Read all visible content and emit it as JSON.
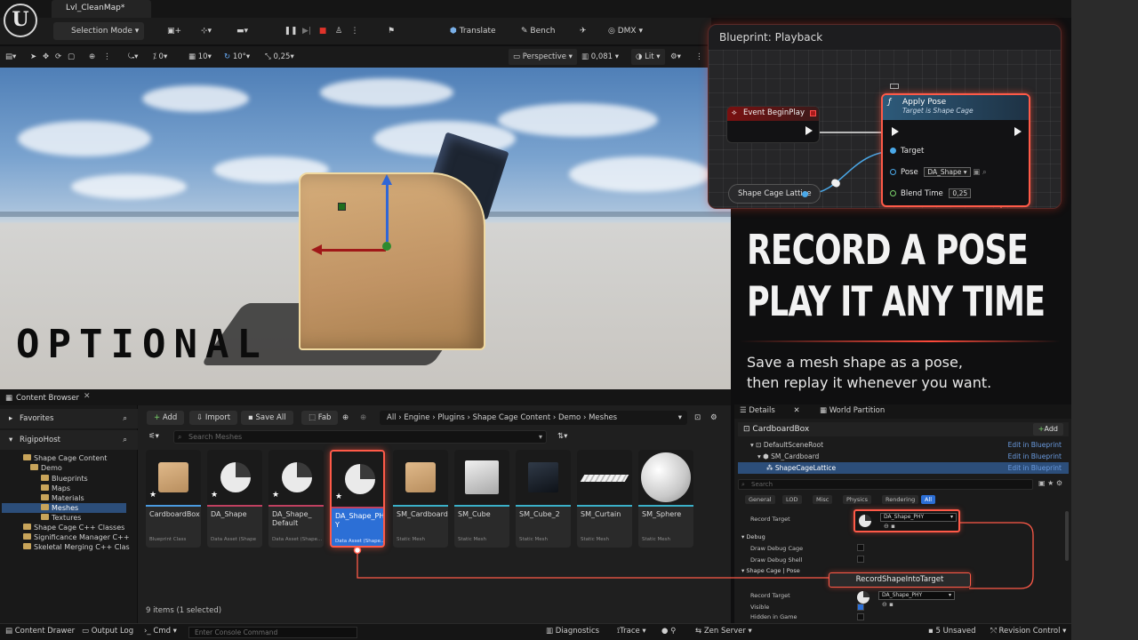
{
  "title_bar": {
    "level_tab": "Lvl_CleanMap*",
    "logo_letter": "U"
  },
  "toolbar": {
    "mode": "Selection Mode",
    "translate": "Translate",
    "bench": "Bench",
    "dmx": "DMX"
  },
  "viewport_toolbar": {
    "grid_snap": "0",
    "grid_size": "10",
    "rot_snap": "10°",
    "scale_snap": "0,25",
    "view_mode": "Perspective",
    "camera_speed": "0,081",
    "lit": "Lit"
  },
  "viewport": {
    "overlay_text": "OPTIONAL"
  },
  "promo": {
    "line1": "RECORD A POSE",
    "line2": "PLAY IT ANY TIME",
    "sub1": "Save a mesh shape as a pose,",
    "sub2": "then replay it whenever you want."
  },
  "blueprint": {
    "title": "Blueprint: Playback",
    "event_node": "Event BeginPlay",
    "apply_title": "Apply Pose",
    "apply_subtitle": "Target is Shape Cage",
    "pin_target": "Target",
    "pin_pose": "Pose",
    "pose_value": "DA_Shape",
    "pin_blend": "Blend Time",
    "blend_value": "0,25",
    "lattice_node": "Shape Cage Lattice"
  },
  "content_browser": {
    "tab": "Content Browser",
    "favorites": "Favorites",
    "root": "RigipoHost",
    "tree": [
      "Shape Cage Content",
      "Demo",
      "Blueprints",
      "Maps",
      "Materials",
      "Meshes",
      "Textures",
      "Shape Cage C++ Classes",
      "Significance Manager C++",
      "Skeletal Merging C++ Clas"
    ],
    "buttons": {
      "add": "Add",
      "import": "Import",
      "save_all": "Save All",
      "fab": "Fab"
    },
    "breadcrumb": [
      "All",
      "Engine",
      "Plugins",
      "Shape Cage Content",
      "Demo",
      "Meshes"
    ],
    "search_placeholder": "Search Meshes",
    "assets": [
      {
        "name": "CardboardBox",
        "type": "Blueprint Class"
      },
      {
        "name": "DA_Shape",
        "type": "Data Asset (Shape"
      },
      {
        "name": "DA_Shape_ Default",
        "type": "Data Asset (Shape..."
      },
      {
        "name": "DA_Shape_PHY",
        "type": "Data Asset (Shape..."
      },
      {
        "name": "SM_Cardboard",
        "type": "Static Mesh"
      },
      {
        "name": "SM_Cube",
        "type": "Static Mesh"
      },
      {
        "name": "SM_Cube_2",
        "type": "Static Mesh"
      },
      {
        "name": "SM_Curtain",
        "type": "Static Mesh"
      },
      {
        "name": "SM_Sphere",
        "type": "Static Mesh"
      }
    ],
    "item_count": "9 items (1 selected)"
  },
  "details": {
    "tab_details": "Details",
    "tab_world": "World Partition",
    "actor": "CardboardBox",
    "add": "Add",
    "components": [
      "DefaultSceneRoot",
      "SM_Cardboard",
      "ShapeCageLattice"
    ],
    "edit_bp": "Edit in Blueprint",
    "search_placeholder": "Search",
    "filters": [
      "General",
      "LOD",
      "Misc",
      "Physics",
      "Rendering",
      "All"
    ],
    "record_target_label": "Record Target",
    "record_target_value": "DA_Shape_PHY",
    "debug": "Debug",
    "draw_debug_cage": "Draw Debug Cage",
    "draw_debug_shell": "Draw Debug Shell",
    "pose_cat": "Shape Cage | Pose",
    "record_button": "RecordShapeIntoTarget",
    "visible": "Visible",
    "hidden_in_game": "Hidden in Game"
  },
  "status_bar": {
    "content_drawer": "Content Drawer",
    "output_log": "Output Log",
    "cmd": "Cmd",
    "console_placeholder": "Enter Console Command",
    "diagnostics": "Diagnostics",
    "trace": "Trace",
    "zen": "Zen Server",
    "unsaved": "5 Unsaved",
    "revision": "Revision Control"
  }
}
